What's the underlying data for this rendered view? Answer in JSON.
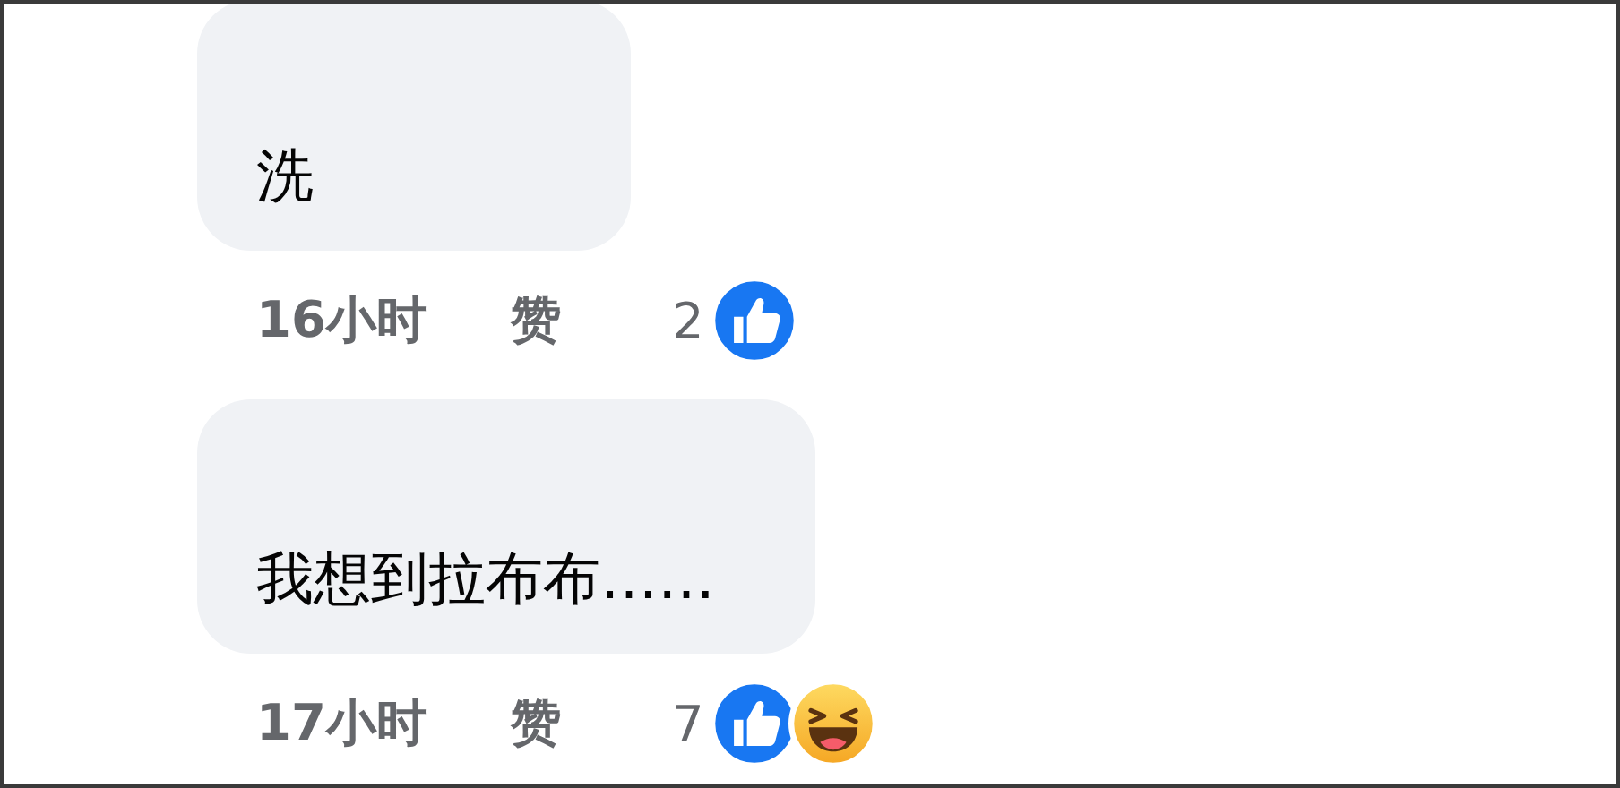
{
  "comments": [
    {
      "text": "洗",
      "time": "16小时",
      "like_label": "赞",
      "reaction_count": "2",
      "reactions": [
        {
          "kind": "like"
        }
      ]
    },
    {
      "text": "我想到拉布布……",
      "time": "17小时",
      "like_label": "赞",
      "reaction_count": "7",
      "reactions": [
        {
          "kind": "like"
        },
        {
          "kind": "haha"
        }
      ]
    }
  ]
}
